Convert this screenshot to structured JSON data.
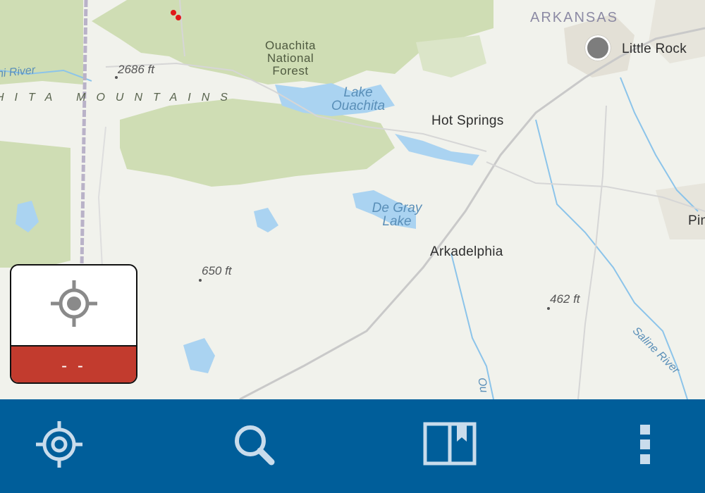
{
  "map": {
    "state_label": "ARKANSAS",
    "cities": [
      {
        "name": "Little Rock"
      },
      {
        "name": "Hot Springs"
      },
      {
        "name": "Arkadelphia"
      },
      {
        "name": "Pin"
      }
    ],
    "water_labels": [
      "Lake Ouachita",
      "De Gray Lake"
    ],
    "forest_label": "Ouachita National Forest",
    "range_label": "HITA MOUNTAINS",
    "river_labels": [
      "hi River",
      "Saline River",
      "Ou"
    ],
    "elevations": [
      "2686 ft",
      "650 ft",
      "462 ft"
    ]
  },
  "location_card": {
    "icon": "crosshair-icon",
    "value": "- -",
    "status_color": "#c23b2e"
  },
  "toolbar": {
    "color": "#005e9a",
    "items": [
      {
        "icon": "locate-icon"
      },
      {
        "icon": "search-icon"
      },
      {
        "icon": "bookmarks-icon"
      },
      {
        "icon": "more-icon"
      }
    ]
  }
}
